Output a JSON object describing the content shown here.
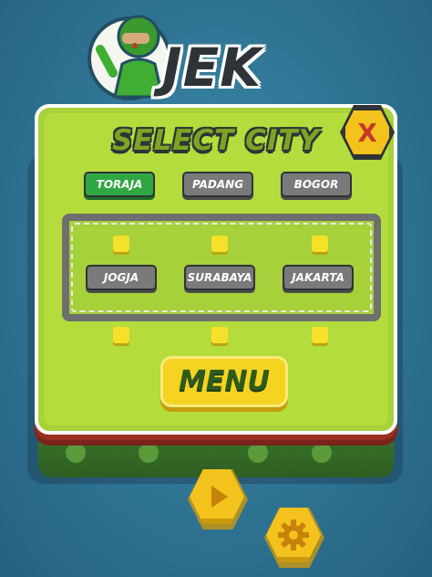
{
  "logo": {
    "text": "JEK"
  },
  "panel": {
    "title": "SELECT CITY",
    "close_label": "X"
  },
  "cities": {
    "row1": [
      "TORAJA",
      "PADANG",
      "BOGOR"
    ],
    "row2": [
      "JOGJA",
      "SURABAYA",
      "JAKARTA"
    ],
    "selected": "TORAJA"
  },
  "menu": {
    "label": "MENU"
  },
  "controls": {
    "play_icon": "play-icon",
    "settings_icon": "gear-icon"
  },
  "colors": {
    "panel": "#b3dc3c",
    "selected_button": "#2fa742",
    "city_button": "#7a7a7a",
    "accent_yellow": "#f3c21c",
    "close_x": "#c43a2a"
  }
}
